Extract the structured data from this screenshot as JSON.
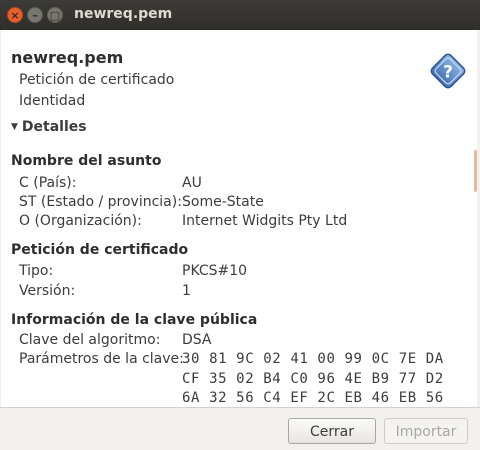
{
  "window": {
    "title": "newreq.pem",
    "close_glyph": "×",
    "min_glyph": "–",
    "max_glyph": "□"
  },
  "header": {
    "name": "newreq.pem",
    "line1": "Petición de certificado",
    "line2": "Identidad",
    "help_icon": "question-mark-diamond",
    "help_glyph": "?"
  },
  "details": {
    "label": "Detalles",
    "arrow": "▼"
  },
  "sections": {
    "subject": {
      "title": "Nombre del asunto",
      "c_label": "C (País):",
      "c_value": "AU",
      "st_label": "ST (Estado / provincia):",
      "st_value": "Some-State",
      "o_label": "O (Organización):",
      "o_value": "Internet Widgits Pty Ltd"
    },
    "request": {
      "title": "Petición de certificado",
      "type_label": "Tipo:",
      "type_value": "PKCS#10",
      "version_label": "Versión:",
      "version_value": "1"
    },
    "pubkey": {
      "title": "Información de la clave pública",
      "algo_label": "Clave del algoritmo:",
      "algo_value": "DSA",
      "params_label": "Parámetros de la clave:",
      "params_lines": [
        "30 81 9C 02 41 00 99 0C 7E DA",
        "CF 35 02 B4 C0 96 4E B9 77 D2",
        "6A 32 56 C4 EF 2C EB 46 EB 56"
      ]
    }
  },
  "buttons": {
    "close": "Cerrar",
    "import": "Importar"
  },
  "colors": {
    "titlebar": "#3c3b37",
    "close_button": "#e4602f",
    "help_icon": "#3f6fb3",
    "scroll_indicator": "#e8b7a2"
  }
}
